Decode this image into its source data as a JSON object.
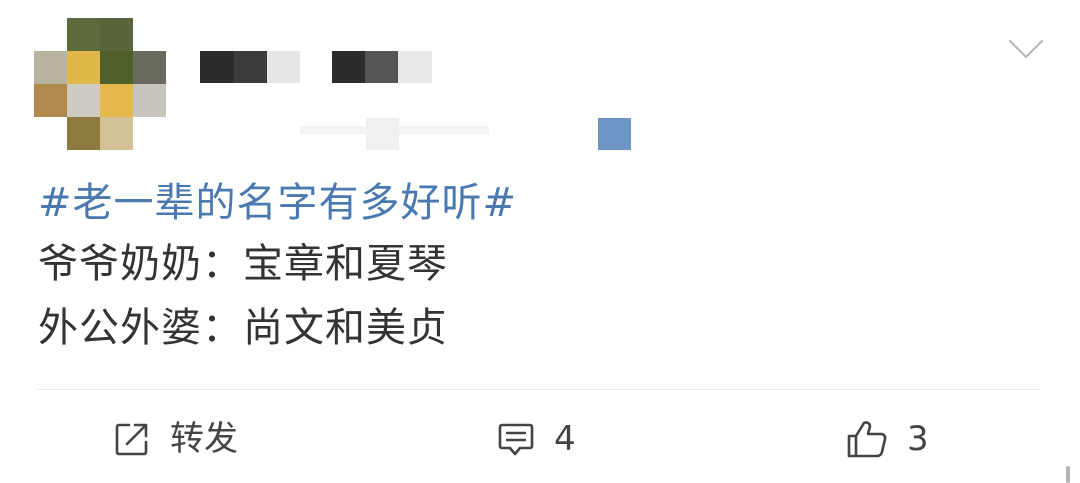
{
  "post": {
    "topic": "#老一辈的名字有多好听#",
    "lines": [
      "爷爷奶奶：宝章和夏琴",
      "外公外婆：尚文和美贞"
    ]
  },
  "actions": {
    "repost_label": "转发",
    "comment_count": "4",
    "like_count": "3"
  },
  "icons": {
    "menu": "chevron-down-icon",
    "repost": "share-icon",
    "comment": "comment-icon",
    "like": "thumbs-up-icon"
  },
  "colors": {
    "topic": "#4a79b0",
    "text": "#333333",
    "icon": "#444444",
    "divider": "#e9e9e9"
  }
}
